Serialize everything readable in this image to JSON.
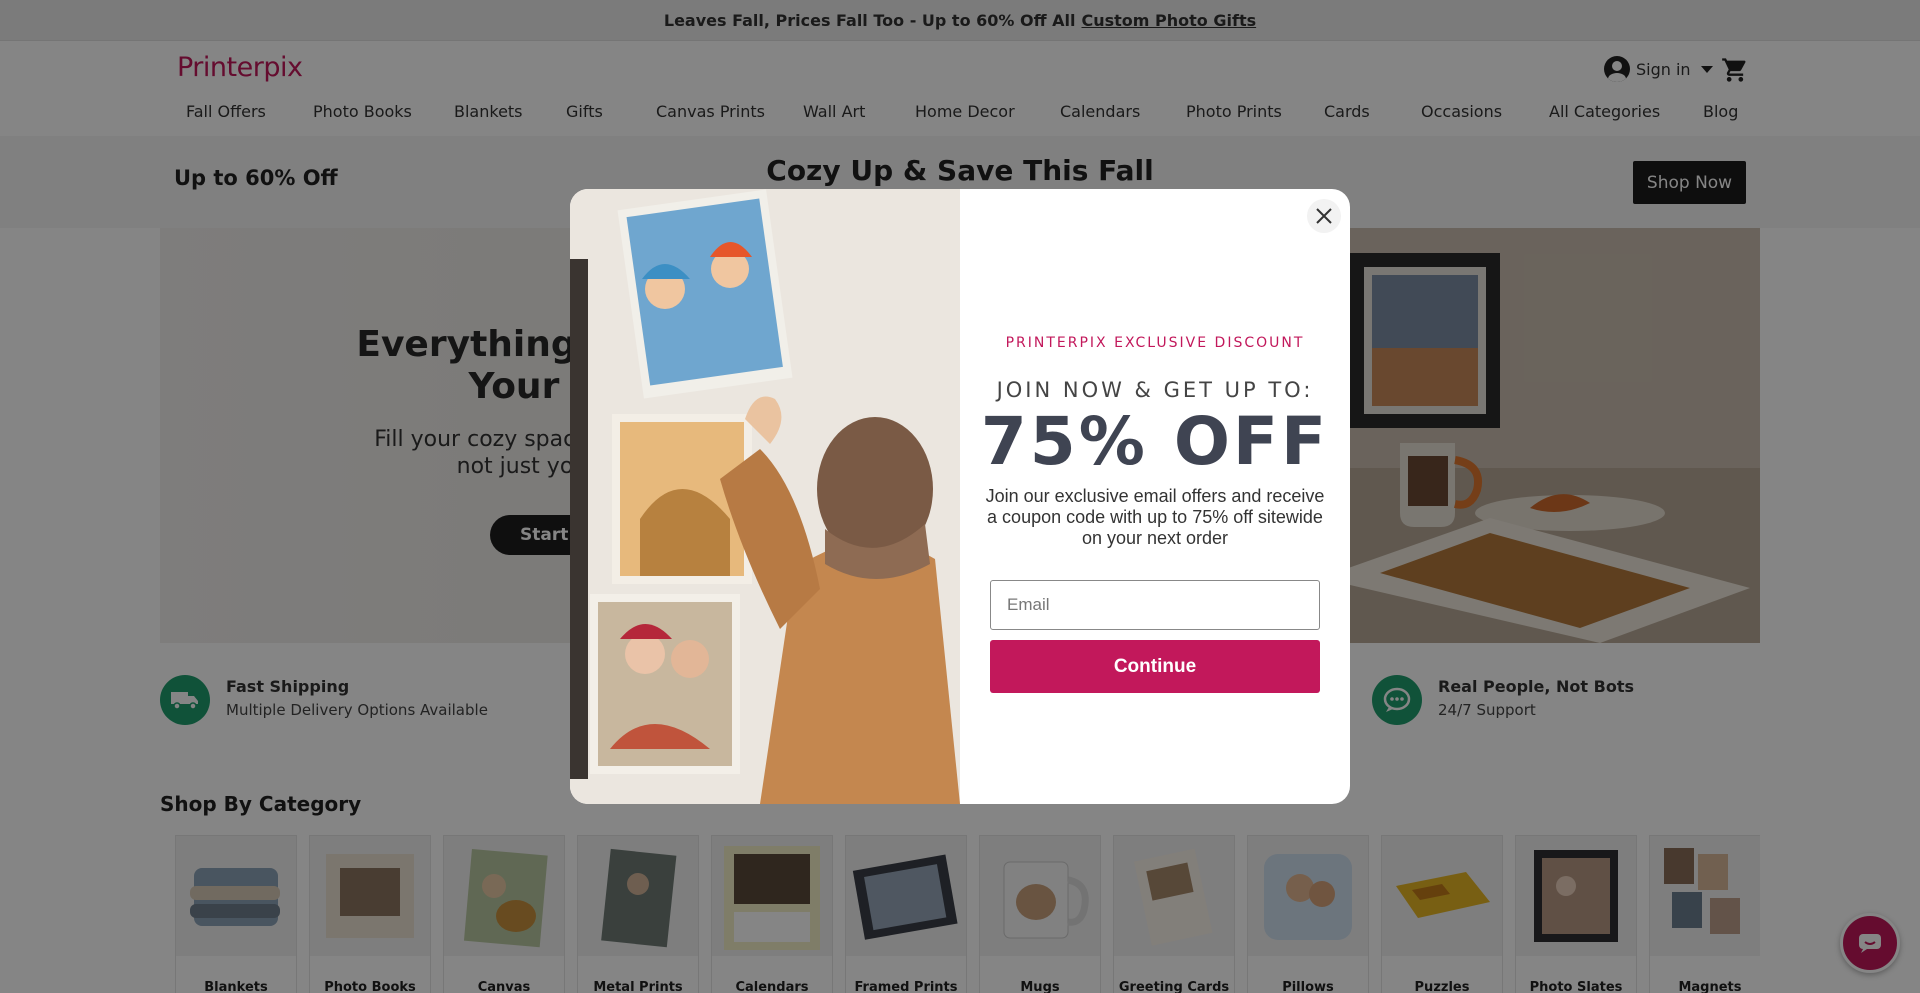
{
  "promo": {
    "text": "Leaves Fall, Prices Fall Too - Up to 60% Off All",
    "link": "Custom Photo Gifts"
  },
  "header": {
    "logo": "Printerpix",
    "signin": "Sign in"
  },
  "nav": [
    "Fall Offers",
    "Photo Books",
    "Blankets",
    "Gifts",
    "Canvas Prints",
    "Wall Art",
    "Home Decor",
    "Calendars",
    "Photo Prints",
    "Cards",
    "Occasions",
    "All Categories",
    "Blog"
  ],
  "sale": {
    "left": "Up to 60% Off",
    "middle": "Cozy Up & Save This Fall",
    "button": "Shop Now"
  },
  "hero": {
    "title_line1": "Everything's Chan",
    "title_line2": "Your W",
    "sub_line1": "Fill your cozy space with mom",
    "sub_line2": "not just your pl",
    "button": "Start M"
  },
  "features": [
    {
      "title": "Fast Shipping",
      "sub": "Multiple Delivery Options Available",
      "icon": "truck-icon"
    },
    {
      "title": "Real People, Not Bots",
      "sub": "24/7 Support",
      "icon": "chat-bubble-icon"
    }
  ],
  "shop_by_category": "Shop By Category",
  "categories": [
    "Blankets",
    "Photo Books",
    "Canvas",
    "Metal Prints",
    "Calendars",
    "Framed Prints",
    "Mugs",
    "Greeting Cards",
    "Pillows",
    "Puzzles",
    "Photo Slates",
    "Magnets"
  ],
  "modal": {
    "eyebrow": "PRINTERPIX EXCLUSIVE DISCOUNT",
    "join": "JOIN NOW & GET UP TO:",
    "big": "75% OFF",
    "description": "Join our exclusive email offers and receive a coupon code with up to 75% off sitewide on your next order",
    "email_placeholder": "Email",
    "continue": "Continue"
  },
  "colors": {
    "brand": "#c2185b",
    "feature_green": "#1f9e6e",
    "dark": "#1c1c1c"
  }
}
